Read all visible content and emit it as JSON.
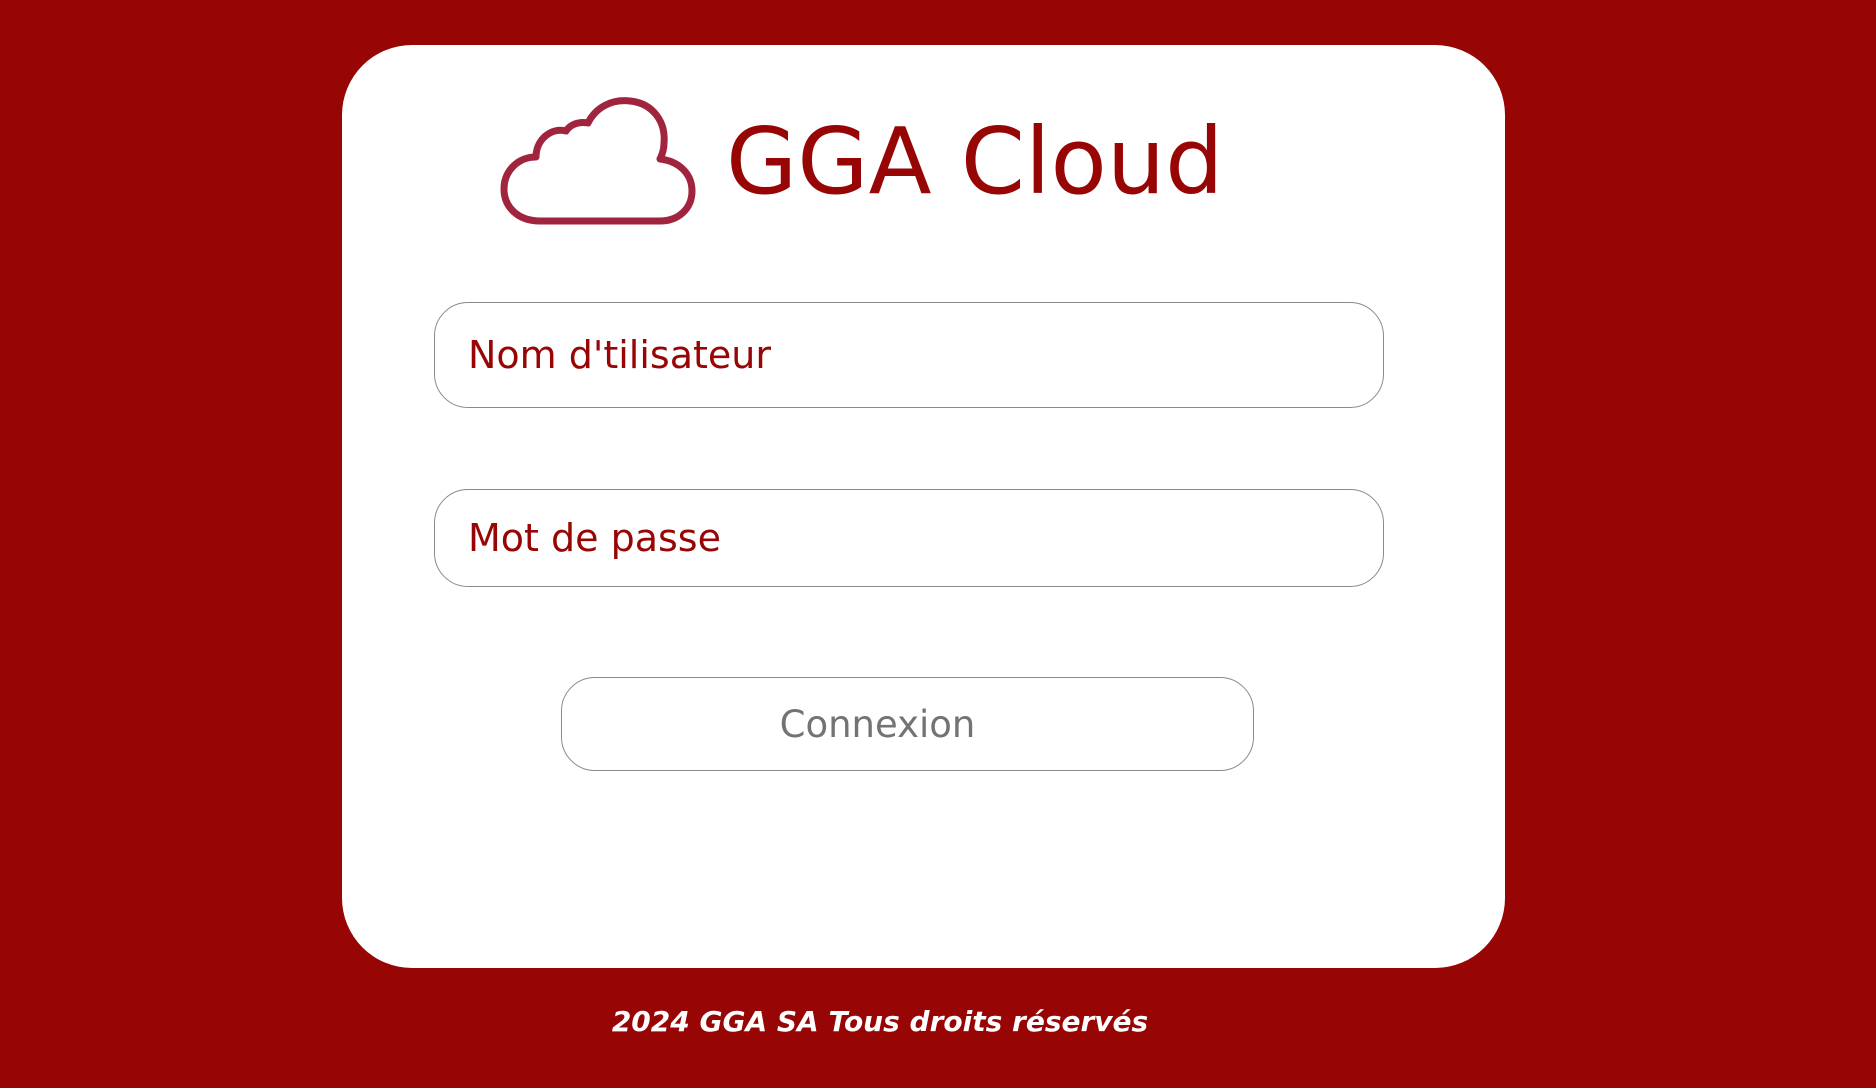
{
  "brand": {
    "title": "GGA Cloud",
    "logo_icon": "cloud-icon"
  },
  "login_form": {
    "username": {
      "placeholder": "Nom d'tilisateur",
      "value": ""
    },
    "password": {
      "placeholder": "Mot de passe",
      "value": ""
    },
    "submit_label": "Connexion"
  },
  "footer": {
    "text": "2024 GGA SA Tous droits réservés"
  },
  "colors": {
    "background": "#970505",
    "card": "#ffffff",
    "accent": "#970505",
    "logo_stroke": "#a0243e",
    "border": "#8a8a8a",
    "button_text": "#737373"
  }
}
